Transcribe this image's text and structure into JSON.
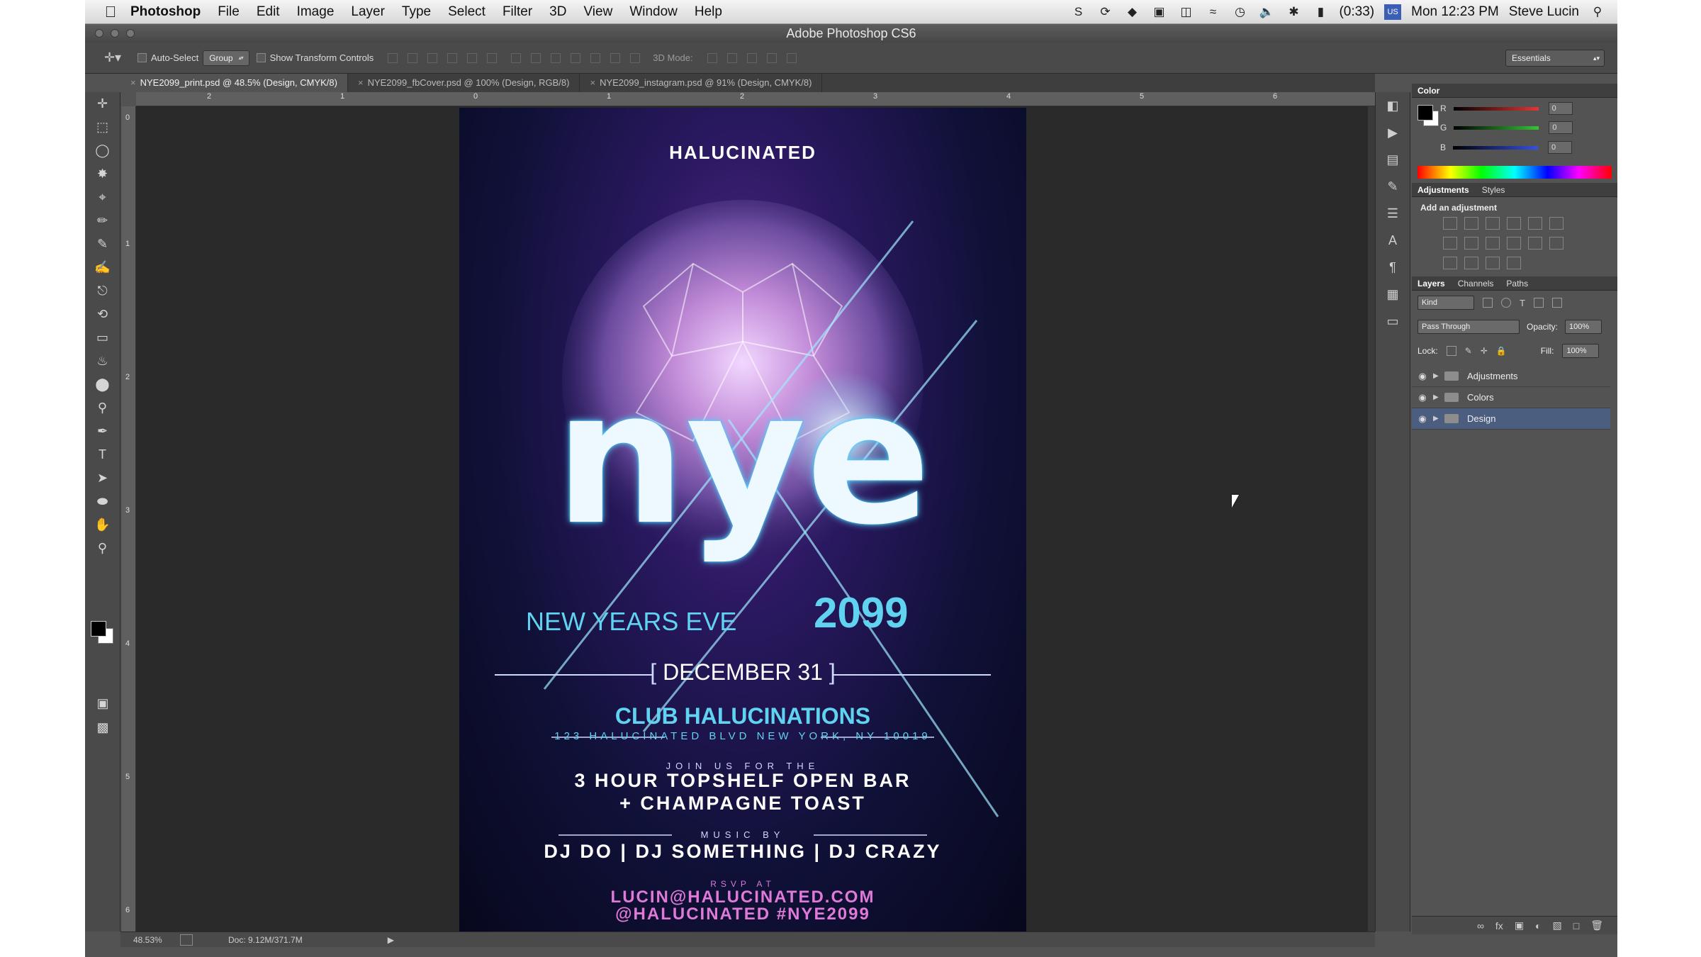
{
  "menubar": {
    "app": "Photoshop",
    "items": [
      "File",
      "Edit",
      "Image",
      "Layer",
      "Type",
      "Select",
      "Filter",
      "3D",
      "View",
      "Window",
      "Help"
    ],
    "battery": "(0:33)",
    "clock": "Mon 12:23 PM",
    "user": "Steve Lucin"
  },
  "window": {
    "title": "Adobe Photoshop CS6"
  },
  "options": {
    "auto_select": "Auto-Select",
    "group": "Group",
    "transform": "Show Transform Controls",
    "mode3d": "3D Mode:",
    "workspace": "Essentials"
  },
  "tabs": [
    {
      "label": "NYE2099_print.psd @ 48.5% (Design, CMYK/8)"
    },
    {
      "label": "NYE2099_fbCover.psd @ 100% (Design, RGB/8)"
    },
    {
      "label": "NYE2099_instagram.psd @ 91% (Design, CMYK/8)"
    }
  ],
  "ruler": {
    "h": [
      "2",
      "1",
      "0",
      "1",
      "2",
      "3",
      "4",
      "5",
      "6"
    ],
    "v": [
      "0",
      "1",
      "2",
      "3",
      "4",
      "5",
      "6"
    ]
  },
  "status": {
    "zoom": "48.53%",
    "doc": "Doc: 9.12M/371.7M"
  },
  "poster": {
    "brand": "HALUCINATED",
    "headline": "nye",
    "subtitle": "NEW YEARS EVE",
    "year": "2099",
    "date": "DECEMBER 31",
    "club": "CLUB HALUCINATIONS",
    "address": "123 HALUCINATED BLVD  NEW YORK, NY 10019",
    "join": "JOIN US FOR THE",
    "bar_line1": "3 HOUR TOPSHELF OPEN BAR",
    "bar_line2": "+ CHAMPAGNE TOAST",
    "music": "MUSIC BY",
    "djs": "DJ DO | DJ SOMETHING | DJ CRAZY",
    "rsvp": "RSVP AT",
    "email": "LUCIN@HALUCINATED.COM",
    "social": "@HALUCINATED #NYE2099"
  },
  "color_panel": {
    "title": "Color",
    "channels": [
      {
        "label": "R",
        "value": "0",
        "color": "#e53535"
      },
      {
        "label": "G",
        "value": "0",
        "color": "#35c435"
      },
      {
        "label": "B",
        "value": "0",
        "color": "#3550e5"
      }
    ]
  },
  "adjustments": {
    "tab1": "Adjustments",
    "tab2": "Styles",
    "hint": "Add an adjustment"
  },
  "layers": {
    "tabs": [
      "Layers",
      "Channels",
      "Paths"
    ],
    "kind": "Kind",
    "blend": "Pass Through",
    "opacity_label": "Opacity:",
    "opacity": "100%",
    "lock_label": "Lock:",
    "fill_label": "Fill:",
    "fill": "100%",
    "rows": [
      {
        "name": "Adjustments"
      },
      {
        "name": "Colors"
      },
      {
        "name": "Design"
      }
    ]
  }
}
